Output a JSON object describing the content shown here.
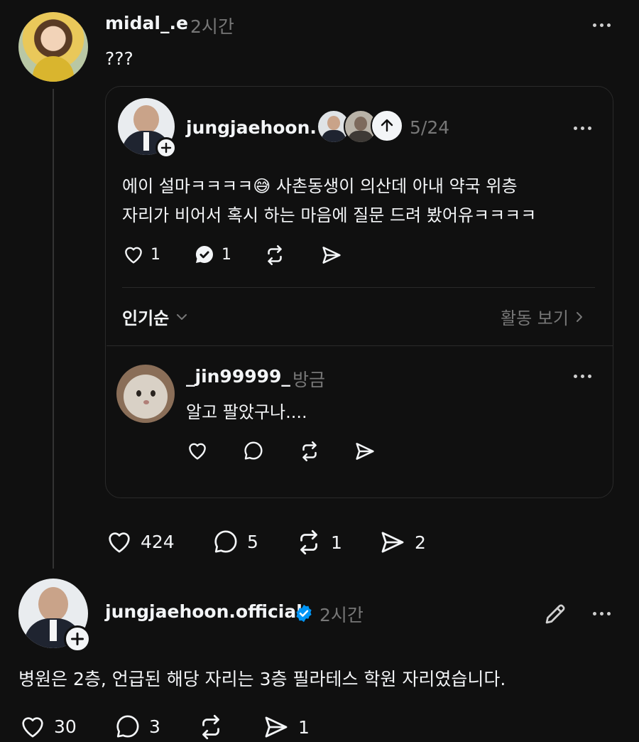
{
  "post1": {
    "username": "midal_.e",
    "time": "2시간",
    "text": "???"
  },
  "quoted": {
    "username": "jungjaehoon.c",
    "date": "5/24",
    "text_line1": "에이 설마ㅋㅋㅋㅋ😅 사촌동생이 의산데 아내 약국 위층",
    "text_line2": "자리가 비어서 혹시 하는 마음에 질문 드려 봤어유ㅋㅋㅋㅋ",
    "likes": "1",
    "replies": "1",
    "sort_label": "인기순",
    "activity_label": "활동 보기",
    "reply": {
      "username": "_jin99999_",
      "time": "방금",
      "text": "알고 팔았구나...."
    }
  },
  "post1_stats": {
    "likes": "424",
    "comments": "5",
    "reposts": "1",
    "shares": "2"
  },
  "post2": {
    "username": "jungjaehoon.official",
    "time": "2시간",
    "text": "병원은 2층, 언급된 해당 자리는 3층 필라테스 학원 자리였습니다.",
    "likes": "30",
    "comments": "3",
    "shares": "1"
  },
  "colors": {
    "background": "#101010",
    "text": "#f3f5f7",
    "muted": "#777777",
    "verified": "#0095f6",
    "border": "#2a2a2a"
  }
}
